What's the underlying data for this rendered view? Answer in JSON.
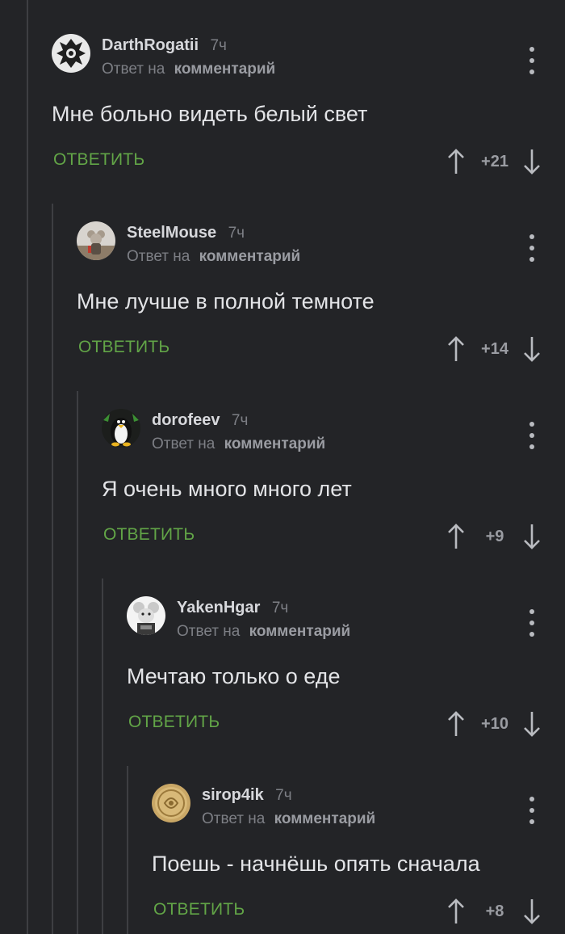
{
  "accent_color": "#62a547",
  "comments": [
    {
      "author": "DarthRogatii",
      "time": "7ч",
      "reply_prefix": "Ответ на",
      "reply_target": "комментарий",
      "text": "Мне больно видеть белый свет",
      "reply_label": "ОТВЕТИТЬ",
      "rating": "+21",
      "avatar": "gothic-emblem-avatar"
    },
    {
      "author": "SteelMouse",
      "time": "7ч",
      "reply_prefix": "Ответ на",
      "reply_target": "комментарий",
      "text": "Мне лучше в полной темноте",
      "reply_label": "ОТВЕТИТЬ",
      "rating": "+14",
      "avatar": "mouse-figure-avatar"
    },
    {
      "author": "dorofeev",
      "time": "7ч",
      "reply_prefix": "Ответ на",
      "reply_target": "комментарий",
      "text": "Я очень много много лет",
      "reply_label": "ОТВЕТИТЬ",
      "rating": "+9",
      "avatar": "penguin-avatar"
    },
    {
      "author": "YakenHgar",
      "time": "7ч",
      "reply_prefix": "Ответ на",
      "reply_target": "комментарий",
      "text": "Мечтаю только о еде",
      "reply_label": "ОТВЕТИТЬ",
      "rating": "+10",
      "avatar": "white-mouse-avatar"
    },
    {
      "author": "sirop4ik",
      "time": "7ч",
      "reply_prefix": "Ответ на",
      "reply_target": "комментарий",
      "text": "Поешь - начнёшь опять сначала",
      "reply_label": "ОТВЕТИТЬ",
      "rating": "+8",
      "avatar": "gold-coin-avatar"
    }
  ]
}
